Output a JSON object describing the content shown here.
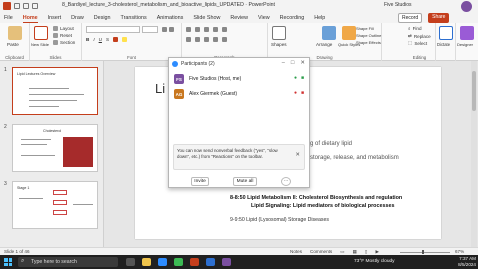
{
  "titlebar": {
    "title": "8_Bardiyel_lecture_3-cholesterol_metabolism_and_bioactive_lipids_UPDATED · PowerPoint",
    "user_label": "Five Studios"
  },
  "tabs": [
    "File",
    "Home",
    "Insert",
    "Draw",
    "Design",
    "Transitions",
    "Animations",
    "Slide Show",
    "Review",
    "View",
    "Recording",
    "Help"
  ],
  "active_tab": "Home",
  "header_actions": {
    "record": "Record",
    "share": "Share"
  },
  "ribbon": {
    "clipboard": {
      "paste": "Paste",
      "label": "Clipboard"
    },
    "slides": {
      "new_slide": "New Slide",
      "layout": "Layout",
      "reset": "Reset",
      "section": "Section",
      "label": "Slides"
    },
    "font": {
      "label": "Font"
    },
    "paragraph": {
      "label": "Paragraph"
    },
    "drawing": {
      "shapes": "Shapes",
      "arrange": "Arrange",
      "quick_styles": "Quick Styles",
      "fill": "Shape Fill",
      "outline": "Shape Outline",
      "effects": "Shape Effects",
      "label": "Drawing"
    },
    "editing": {
      "find": "Find",
      "replace": "Replace",
      "select": "Select",
      "label": "Editing"
    },
    "dictate": "Dictate",
    "designer": "Designer"
  },
  "thumbnails": [
    {
      "num": "1",
      "title": "Lipid Lectures Overview"
    },
    {
      "num": "2",
      "title": "Cholesterol"
    },
    {
      "num": "3",
      "title": "Stage 1"
    }
  ],
  "slide": {
    "title": "Li",
    "line1": "g of dietary lipid",
    "line2": "storage, release, and metabolism",
    "line3": "8-8:50 Lipid Metabolism II: Cholesterol Biosynthesis and regulation",
    "line4": "Lipid Signaling: Lipid mediators of biological processes",
    "line5": "9-9:50 Lipid (Lysosomal) Storage Diseases"
  },
  "participants": {
    "title": "Participants (2)",
    "people": [
      {
        "initials": "FS",
        "name": "Five Studios (Host, me)",
        "color": "#7a4fa0"
      },
      {
        "initials": "AG",
        "name": "Alex Giermek (Guest)",
        "color": "#c8771f"
      }
    ],
    "notice": "You can now send nonverbal feedback (\"yes\", \"slow down\", etc.) from \"Reactions\" on the toolbar.",
    "invite": "Invite",
    "mute_all": "Mute all",
    "more": "···"
  },
  "status": {
    "slide_info": "Slide 1 of 46",
    "notes": "Notes",
    "comments": "Comments",
    "zoom": "67%"
  },
  "taskbar": {
    "search_placeholder": "Type here to search",
    "weather": "73°F  Mostly cloudy",
    "time": "7:37 AM",
    "date": "8/5/2024"
  }
}
